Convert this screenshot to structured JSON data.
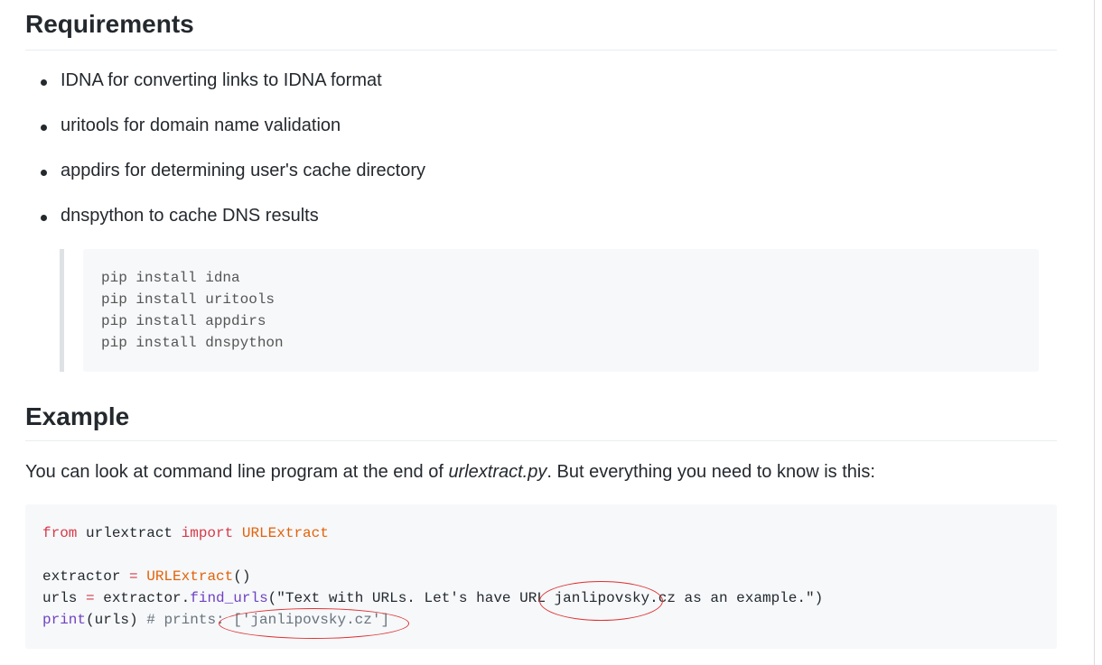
{
  "requirements": {
    "heading": "Requirements",
    "items": [
      "IDNA for converting links to IDNA format",
      "uritools for domain name validation",
      "appdirs for determining user's cache directory",
      "dnspython to cache DNS results"
    ],
    "install_lines": [
      "pip install idna",
      "pip install uritools",
      "pip install appdirs",
      "pip install dnspython"
    ]
  },
  "example": {
    "heading": "Example",
    "intro_before": "You can look at command line program at the end of ",
    "intro_em": "urlextract.py",
    "intro_after": ". But everything you need to know is this:",
    "code": {
      "l1_from": "from",
      "l1_mod": " urlextract ",
      "l1_import": "import",
      "l1_cls": " URLExtract",
      "l3_var": "extractor ",
      "l3_eq": "=",
      "l3_cls": " URLExtract",
      "l3_paren": "()",
      "l4_a": "urls ",
      "l4_eq": "=",
      "l4_b": " extractor.",
      "l4_fn": "find_urls",
      "l4_str": "(\"Text with URLs. Let's have URL janlipovsky.cz as an example.\")",
      "l5_print": "print",
      "l5_rest": "(urls) ",
      "l5_comment": "# prints: ['janlipovsky.cz']"
    },
    "annotation_color": "#e03030"
  }
}
